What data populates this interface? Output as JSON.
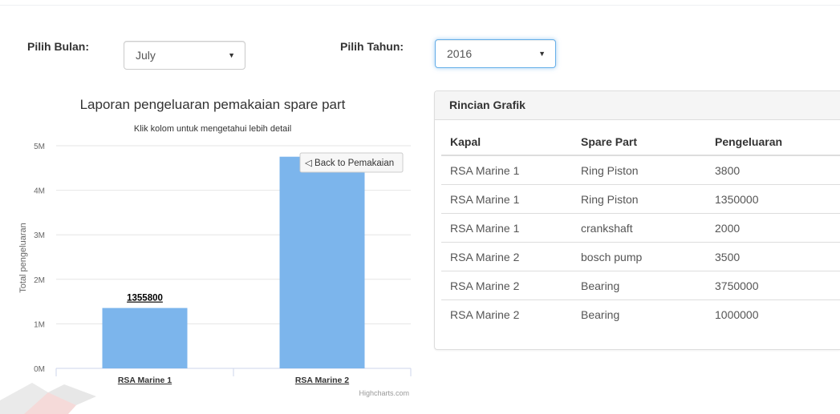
{
  "filters": {
    "month_label": "Pilih Bulan:",
    "month_value": "July",
    "year_label": "Pilih Tahun:",
    "year_value": "2016"
  },
  "chart": {
    "back_button": "◁ Back to Pemakaian",
    "credits": "Highcharts.com"
  },
  "chart_data": {
    "type": "bar",
    "title": "Laporan pengeluaran pemakaian spare part",
    "subtitle": "Klik kolom untuk mengetahui lebih detail",
    "ylabel": "Total pengeluaran",
    "xlabel": "",
    "categories": [
      "RSA Marine 1",
      "RSA Marine 2"
    ],
    "values": [
      1355800,
      4753500
    ],
    "data_labels": [
      "1355800",
      ""
    ],
    "y_ticks": [
      "0M",
      "1M",
      "2M",
      "3M",
      "4M",
      "5M"
    ],
    "ylim": [
      0,
      5000000
    ],
    "color": "#7cb5ec",
    "grid": true,
    "legend": "none"
  },
  "details": {
    "title": "Rincian Grafik",
    "headers": [
      "Kapal",
      "Spare Part",
      "Pengeluaran"
    ],
    "rows": [
      [
        "RSA Marine 1",
        "Ring Piston",
        "3800"
      ],
      [
        "RSA Marine 1",
        "Ring Piston",
        "1350000"
      ],
      [
        "RSA Marine 1",
        "crankshaft",
        "2000"
      ],
      [
        "RSA Marine 2",
        "bosch pump",
        "3500"
      ],
      [
        "RSA Marine 2",
        "Bearing",
        "3750000"
      ],
      [
        "RSA Marine 2",
        "Bearing",
        "1000000"
      ]
    ]
  },
  "icons": {
    "select_caret": "caret-down-icon",
    "logo": "watermark-logo-icon"
  }
}
